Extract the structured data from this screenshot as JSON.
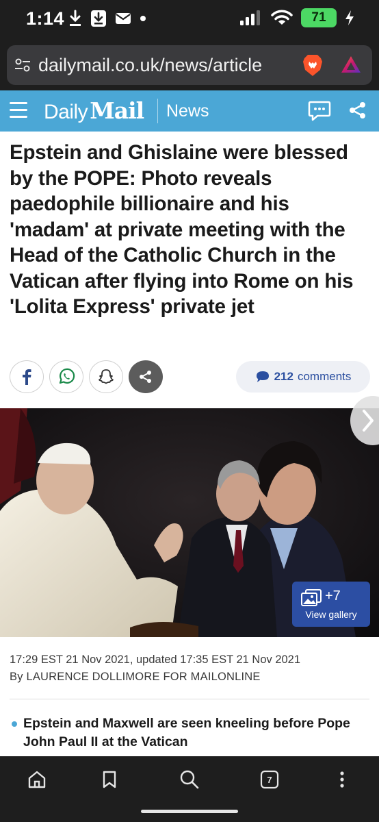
{
  "status_bar": {
    "time": "1:14",
    "battery": "71",
    "icons": [
      "download-icon",
      "download-box-icon",
      "mail-icon",
      "dot-icon",
      "signal-icon",
      "wifi-icon",
      "charging-icon"
    ]
  },
  "browser": {
    "url": "dailymail.co.uk/news/article",
    "icons": [
      "site-settings-icon",
      "brave-shield-icon",
      "brave-rewards-icon"
    ]
  },
  "site_header": {
    "logo_daily": "Daily",
    "logo_mail": "Mail",
    "section": "News",
    "color": "#4ba7d6"
  },
  "article": {
    "headline": "Epstein and Ghislaine were blessed by the POPE: Photo reveals paedophile billionaire and his 'madam' at private meeting with the Head of the Catholic Church in the Vatican after flying into Rome on his 'Lolita Express' private jet",
    "share_buttons": [
      "facebook-icon",
      "whatsapp-icon",
      "snapchat-icon",
      "share-icon"
    ],
    "comments_count": "212",
    "comments_label": "comments",
    "gallery_count": "+7",
    "gallery_label": "View gallery",
    "timestamp": "17:29 EST 21 Nov 2021, updated 17:35 EST 21 Nov 2021",
    "byline": "By LAURENCE DOLLIMORE FOR MAILONLINE",
    "bullets": [
      "Epstein and Maxwell are seen kneeling before Pope John Paul II at the Vatican"
    ]
  },
  "bottom_toolbar": {
    "tabs_count": "7",
    "icons": [
      "home-icon",
      "bookmark-icon",
      "search-icon",
      "tabs-icon",
      "more-icon"
    ]
  }
}
